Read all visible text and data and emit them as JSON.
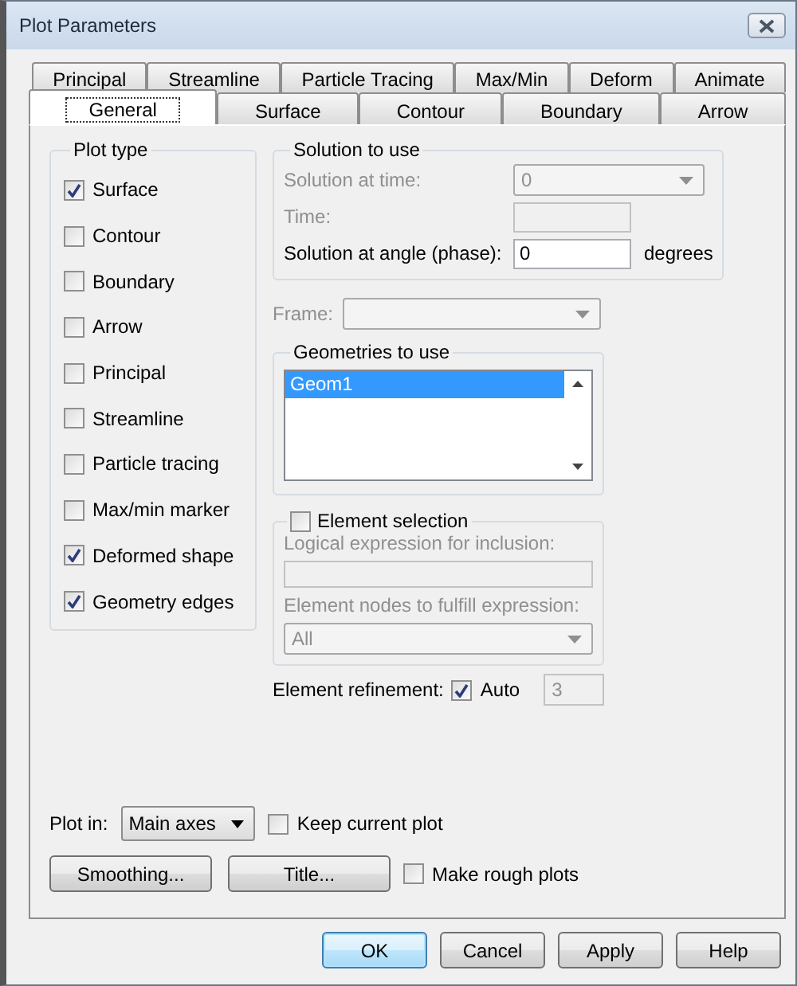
{
  "window": {
    "title": "Plot Parameters"
  },
  "tab_rows": [
    {
      "tabs": [
        {
          "label": "Principal",
          "selected": false
        },
        {
          "label": "Streamline",
          "selected": false
        },
        {
          "label": "Particle Tracing",
          "selected": false
        },
        {
          "label": "Max/Min",
          "selected": false
        },
        {
          "label": "Deform",
          "selected": false
        },
        {
          "label": "Animate",
          "selected": false
        }
      ]
    },
    {
      "tabs": [
        {
          "label": "General",
          "selected": true
        },
        {
          "label": "Surface",
          "selected": false
        },
        {
          "label": "Contour",
          "selected": false
        },
        {
          "label": "Boundary",
          "selected": false
        },
        {
          "label": "Arrow",
          "selected": false
        }
      ]
    }
  ],
  "plot_type": {
    "title": "Plot type",
    "items": [
      {
        "label": "Surface",
        "checked": true
      },
      {
        "label": "Contour",
        "checked": false
      },
      {
        "label": "Boundary",
        "checked": false
      },
      {
        "label": "Arrow",
        "checked": false
      },
      {
        "label": "Principal",
        "checked": false
      },
      {
        "label": "Streamline",
        "checked": false
      },
      {
        "label": "Particle tracing",
        "checked": false
      },
      {
        "label": "Max/min marker",
        "checked": false
      },
      {
        "label": "Deformed shape",
        "checked": true
      },
      {
        "label": "Geometry edges",
        "checked": true
      }
    ]
  },
  "solution": {
    "title": "Solution to use",
    "rows": [
      {
        "kind": "dropdown",
        "label": "Solution at time:",
        "value": "0",
        "disabled": true
      },
      {
        "kind": "field",
        "label": "Time:",
        "disabled": true
      },
      {
        "kind": "field",
        "label": "Solution at angle (phase):",
        "value": "0",
        "unit": "degrees",
        "disabled": false
      }
    ]
  },
  "frame": {
    "label": "Frame:",
    "disabled": true
  },
  "geometries": {
    "title": "Geometries to use",
    "items": [
      {
        "label": "Geom1",
        "selected": true
      }
    ]
  },
  "element_selection": {
    "label": "Element selection",
    "checked": false,
    "expression_label": "Logical expression for inclusion:",
    "nodes_label": "Element nodes to fulfill expression:",
    "nodes_value": "All"
  },
  "refinement": {
    "label": "Element refinement:",
    "auto_label": "Auto",
    "auto_checked": true,
    "value": "3"
  },
  "plot_in": {
    "label": "Plot in:",
    "value": "Main axes"
  },
  "keep_current": {
    "label": "Keep current plot",
    "checked": false
  },
  "actions": [
    "Smoothing...",
    "Title..."
  ],
  "rough_plots": {
    "label": "Make rough plots",
    "checked": false
  },
  "buttons": [
    {
      "label": "OK",
      "default": true
    },
    {
      "label": "Cancel",
      "default": false
    },
    {
      "label": "Apply",
      "default": false
    },
    {
      "label": "Help",
      "default": false
    }
  ]
}
